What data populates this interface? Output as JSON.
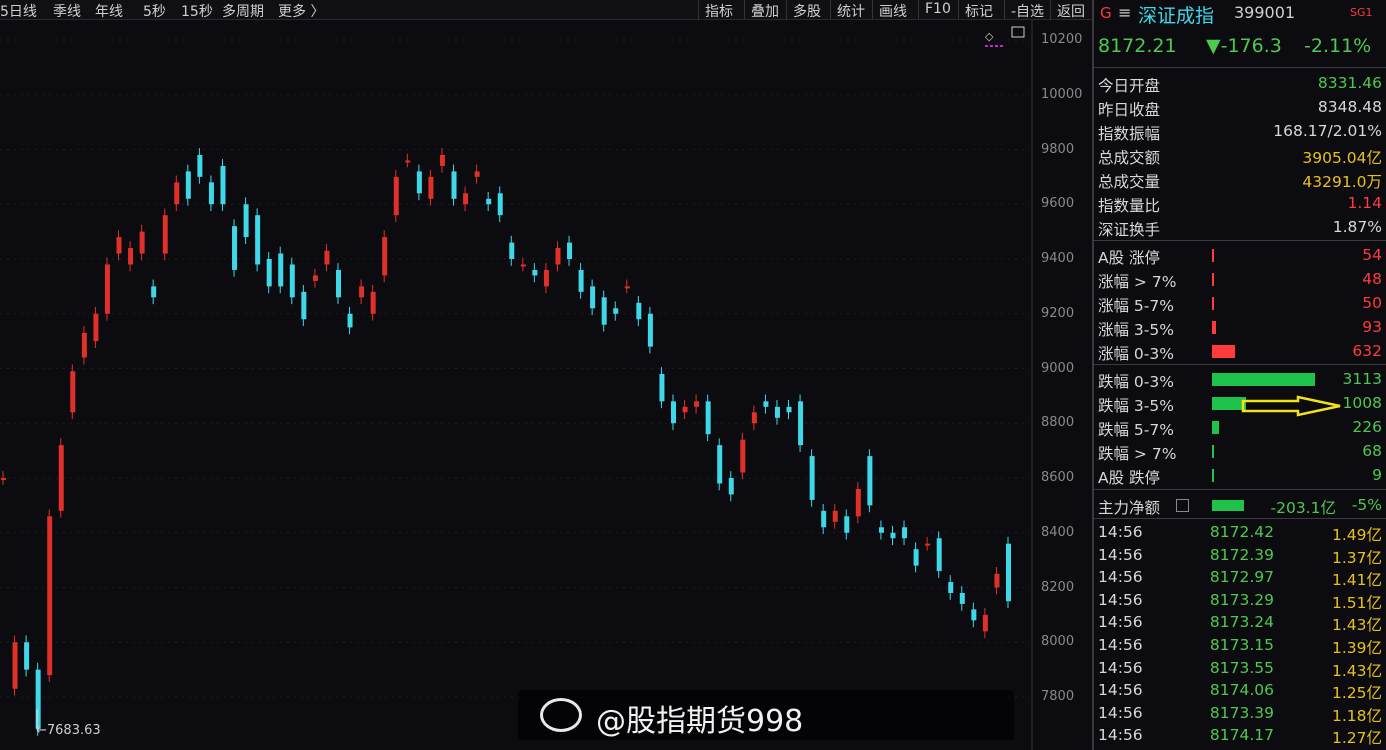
{
  "toolbar": {
    "left": [
      "5日线",
      "季线",
      "年线",
      "5秒",
      "15秒",
      "多周期",
      "更多 〉"
    ],
    "right": [
      "指标",
      "叠加",
      "多股",
      "统计",
      "画线",
      "F10",
      "标记",
      "-自选",
      "返回"
    ]
  },
  "header": {
    "g": "G",
    "menu": "≡",
    "name": "深证成指",
    "code": "399001",
    "tag": "SG1",
    "price": "8172.21",
    "change": "▼-176.3",
    "pct": "-2.11%"
  },
  "stats": [
    {
      "label": "今日开盘",
      "value": "8331.46",
      "color": "#4ec94e"
    },
    {
      "label": "昨日收盘",
      "value": "8348.48",
      "color": "#d8d8d8"
    },
    {
      "label": "指数振幅",
      "value": "168.17/2.01%",
      "color": "#d8d8d8"
    },
    {
      "label": "总成交额",
      "value": "3905.04亿",
      "color": "#e8c020"
    },
    {
      "label": "总成交量",
      "value": "43291.0万",
      "color": "#e8c020"
    },
    {
      "label": "指数量比",
      "value": "1.14",
      "color": "#ff3b3b"
    },
    {
      "label": "深证换手",
      "value": "1.87%",
      "color": "#d8d8d8"
    }
  ],
  "breadth_up": [
    {
      "label": "A股 涨停",
      "value": "54",
      "bar": 0.005
    },
    {
      "label": "涨幅 > 7%",
      "value": "48",
      "bar": 0.005
    },
    {
      "label": "涨幅 5-7%",
      "value": "50",
      "bar": 0.005
    },
    {
      "label": "涨幅 3-5%",
      "value": "93",
      "bar": 0.035
    },
    {
      "label": "涨幅 0-3%",
      "value": "632",
      "bar": 0.22
    }
  ],
  "breadth_down": [
    {
      "label": "跌幅 0-3%",
      "value": "3113",
      "bar": 1.0
    },
    {
      "label": "跌幅 3-5%",
      "value": "1008",
      "bar": 0.33
    },
    {
      "label": "跌幅 5-7%",
      "value": "226",
      "bar": 0.07
    },
    {
      "label": "跌幅 > 7%",
      "value": "68",
      "bar": 0.005
    },
    {
      "label": "A股 跌停",
      "value": "9",
      "bar": 0.005
    }
  ],
  "mainflow": {
    "label": "主力净额",
    "value": "-203.1亿",
    "pct": "-5%"
  },
  "ticks": [
    {
      "t": "14:56",
      "p": "8172.42",
      "a": "1.49亿"
    },
    {
      "t": "14:56",
      "p": "8172.39",
      "a": "1.37亿"
    },
    {
      "t": "14:56",
      "p": "8172.97",
      "a": "1.41亿"
    },
    {
      "t": "14:56",
      "p": "8173.29",
      "a": "1.51亿"
    },
    {
      "t": "14:56",
      "p": "8173.24",
      "a": "1.43亿"
    },
    {
      "t": "14:56",
      "p": "8173.15",
      "a": "1.39亿"
    },
    {
      "t": "14:56",
      "p": "8173.55",
      "a": "1.43亿"
    },
    {
      "t": "14:56",
      "p": "8174.06",
      "a": "1.25亿"
    },
    {
      "t": "14:56",
      "p": "8173.39",
      "a": "1.18亿"
    },
    {
      "t": "14:56",
      "p": "8174.17",
      "a": "1.27亿"
    }
  ],
  "watermark": "@股指期货998",
  "colors": {
    "up": "#e0302a",
    "down": "#3fd8e8",
    "green": "#1fc24a",
    "red": "#ff3b3b"
  },
  "chart_data": {
    "type": "candlestick",
    "ylim": [
      7700,
      10250
    ],
    "yticks": [
      10200,
      10000,
      9800,
      9600,
      9400,
      9200,
      9000,
      8800,
      8600,
      8400,
      8200,
      8000,
      7800
    ],
    "low_marker": "7683.63",
    "pts": [
      [
        8600
      ],
      [
        7830,
        8000
      ],
      [
        7900
      ],
      [
        7683.63
      ],
      [
        7880,
        8460
      ],
      [
        8480,
        8720
      ],
      [
        8840,
        8990
      ],
      [
        9040,
        9130
      ],
      [
        9100,
        9200
      ],
      [
        9200,
        9380
      ],
      [
        9420,
        9480
      ],
      [
        9380,
        9440
      ],
      [
        9420,
        9500
      ],
      [
        9300,
        9260
      ],
      [
        9420,
        9560
      ],
      [
        9600,
        9680
      ],
      [
        9720,
        9620
      ],
      [
        9780,
        9700
      ],
      [
        9680,
        9600
      ],
      [
        9740,
        9600
      ],
      [
        9520,
        9360
      ],
      [
        9600,
        9480
      ],
      [
        9560,
        9380
      ],
      [
        9400,
        9300
      ],
      [
        9420,
        9300
      ],
      [
        9380,
        9260
      ],
      [
        9280,
        9180
      ],
      [
        9320,
        9340
      ],
      [
        9380,
        9430
      ],
      [
        9360,
        9260
      ],
      [
        9200,
        9150
      ],
      [
        9260,
        9300
      ],
      [
        9200,
        9280
      ],
      [
        9340,
        9480
      ],
      [
        9560,
        9700
      ],
      [
        9760,
        9760
      ],
      [
        9720,
        9640
      ],
      [
        9620,
        9700
      ],
      [
        9740,
        9780
      ],
      [
        9720,
        9620
      ],
      [
        9600,
        9640
      ],
      [
        9700,
        9720
      ],
      [
        9620,
        9600
      ],
      [
        9640,
        9560
      ],
      [
        9460,
        9400
      ],
      [
        9380,
        9380
      ],
      [
        9360,
        9340
      ],
      [
        9300,
        9360
      ],
      [
        9380,
        9440
      ],
      [
        9460,
        9400
      ],
      [
        9360,
        9280
      ],
      [
        9300,
        9220
      ],
      [
        9260,
        9160
      ],
      [
        9220,
        9200
      ],
      [
        9300,
        9300
      ],
      [
        9240,
        9180
      ],
      [
        9200,
        9080
      ],
      [
        8980,
        8880
      ],
      [
        8880,
        8800
      ],
      [
        8840,
        8860
      ],
      [
        8860,
        8880
      ],
      [
        8880,
        8760
      ],
      [
        8720,
        8580
      ],
      [
        8600,
        8540
      ],
      [
        8620,
        8740
      ],
      [
        8800,
        8840
      ],
      [
        8880,
        8860
      ],
      [
        8860,
        8820
      ],
      [
        8860,
        8840
      ],
      [
        8880,
        8720
      ],
      [
        8680,
        8520
      ],
      [
        8480,
        8420
      ],
      [
        8440,
        8480
      ],
      [
        8460,
        8400
      ],
      [
        8460,
        8560
      ],
      [
        8680,
        8500
      ],
      [
        8420,
        8400
      ],
      [
        8400,
        8380
      ],
      [
        8420,
        8380
      ],
      [
        8340,
        8280
      ],
      [
        8360,
        8360
      ],
      [
        8380,
        8260
      ],
      [
        8220,
        8180
      ],
      [
        8180,
        8140
      ],
      [
        8120,
        8080
      ],
      [
        8040,
        8100
      ],
      [
        8200,
        8250
      ],
      [
        8360,
        8150
      ]
    ]
  }
}
